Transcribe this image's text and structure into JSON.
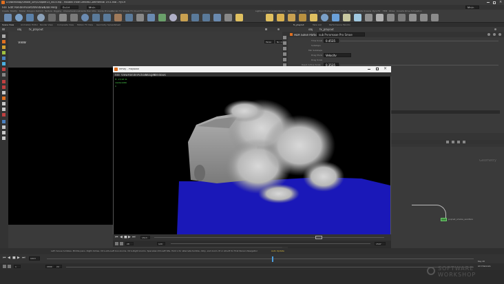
{
  "window": {
    "title": "D:/Workshop/Smoke_Sim/Chapter23_v003.hip - Houdini Indie Limited-Commercial 19.5.368 - Py3.9"
  },
  "menubar": {
    "items": [
      "File",
      "Edit",
      "Render",
      "Assets",
      "Windows",
      "Labs",
      "Help"
    ],
    "desktop": "Build",
    "mode": "Main"
  },
  "shelf_left": {
    "tabs": [
      "Create",
      "Modify",
      "Model",
      "Polygon",
      "Deform",
      "Texture",
      "Rigging",
      "Characters",
      "Constraints",
      "Hair Utils",
      "Guide Process",
      "Terrain FX",
      "Simple FX",
      "Cloud FX",
      "Volume"
    ]
  },
  "shelf_right": {
    "tabs": [
      "Lights and Cameras",
      "Collisions",
      "Particles",
      "Grains",
      "Vellum",
      "Rigid Bodies",
      "Particle Fluids",
      "Viscous Fluids",
      "Oceans",
      "Pyro FX",
      "FEM",
      "Wires",
      "Crowds",
      "Drive Simulation"
    ]
  },
  "viewer": {
    "tabs": [
      "Scene View",
      "Animation Editor",
      "Render View",
      "Composite View",
      "Motion FX View",
      "Geometry Spreadsheet"
    ],
    "path": "obj",
    "node": "fx_playout",
    "view_label": "View",
    "persp": "Persp",
    "cam": "No cam"
  },
  "params": {
    "tabs": [
      "fx_playout",
      "Take List",
      "Performance Monitor"
    ],
    "node_type": "HDA Solve Particles",
    "node_name": "sub Pyromage Pro Smoe",
    "rows": [
      {
        "label": "Time Scale",
        "value": "0.4535"
      },
      {
        "label": "Substeps",
        "value": ""
      },
      {
        "label": "Min Substeps",
        "value": ""
      },
      {
        "label": "Drag Mode",
        "value": "Velocity"
      },
      {
        "label": "Drag Scale",
        "value": ""
      },
      {
        "label": "Reset Active Scale",
        "value": "0.3535"
      }
    ]
  },
  "mplay": {
    "title": "MPlay - Playback",
    "menu": [
      "File",
      "View",
      "Render",
      "Actions",
      "Images",
      "Windows"
    ],
    "overlay_frame": "Fr. 17/18 31",
    "overlay_res": "1920x1080",
    "overlay_ch": "C",
    "timeline1": {
      "frame": "1513",
      "start": "28"
    },
    "timeline2": {
      "start": "129",
      "end": "1507"
    }
  },
  "network": {
    "label": "Geometry",
    "node_label": "popnet_smoke_sandbox"
  },
  "status": {
    "message": "Left mouse tumbles. Middle pans. Right dollies. Ctrl+Alt+Left box-zooms. Ctrl+Right zooms. Spacebar-Ctrl-Left tilts. Hold L for alternate tumble, dolly, and zoom.  M or Alt+M for First Person Navigation.",
    "right": "Auto Update"
  },
  "playbar": {
    "frame": "1013",
    "start": "1",
    "end": "2000",
    "fps": "24",
    "key_all": "Key All",
    "all_channels": "All Channels"
  },
  "watermark": {
    "line1": "SOFTWARE",
    "line2": "WORKSHOP"
  },
  "icons": [
    "menu-icon",
    "close-icon",
    "maximize-icon",
    "minimize-icon",
    "play-icon",
    "stop-icon",
    "first-frame-icon",
    "last-frame-icon",
    "step-back-icon",
    "step-forward-icon",
    "gear-icon",
    "eye-icon",
    "lock-icon",
    "pin-icon",
    "home-icon",
    "search-icon"
  ],
  "colors": {
    "accent": "#f0a030",
    "ground": "#1a18b8",
    "node_green": "#3c8c3c"
  }
}
